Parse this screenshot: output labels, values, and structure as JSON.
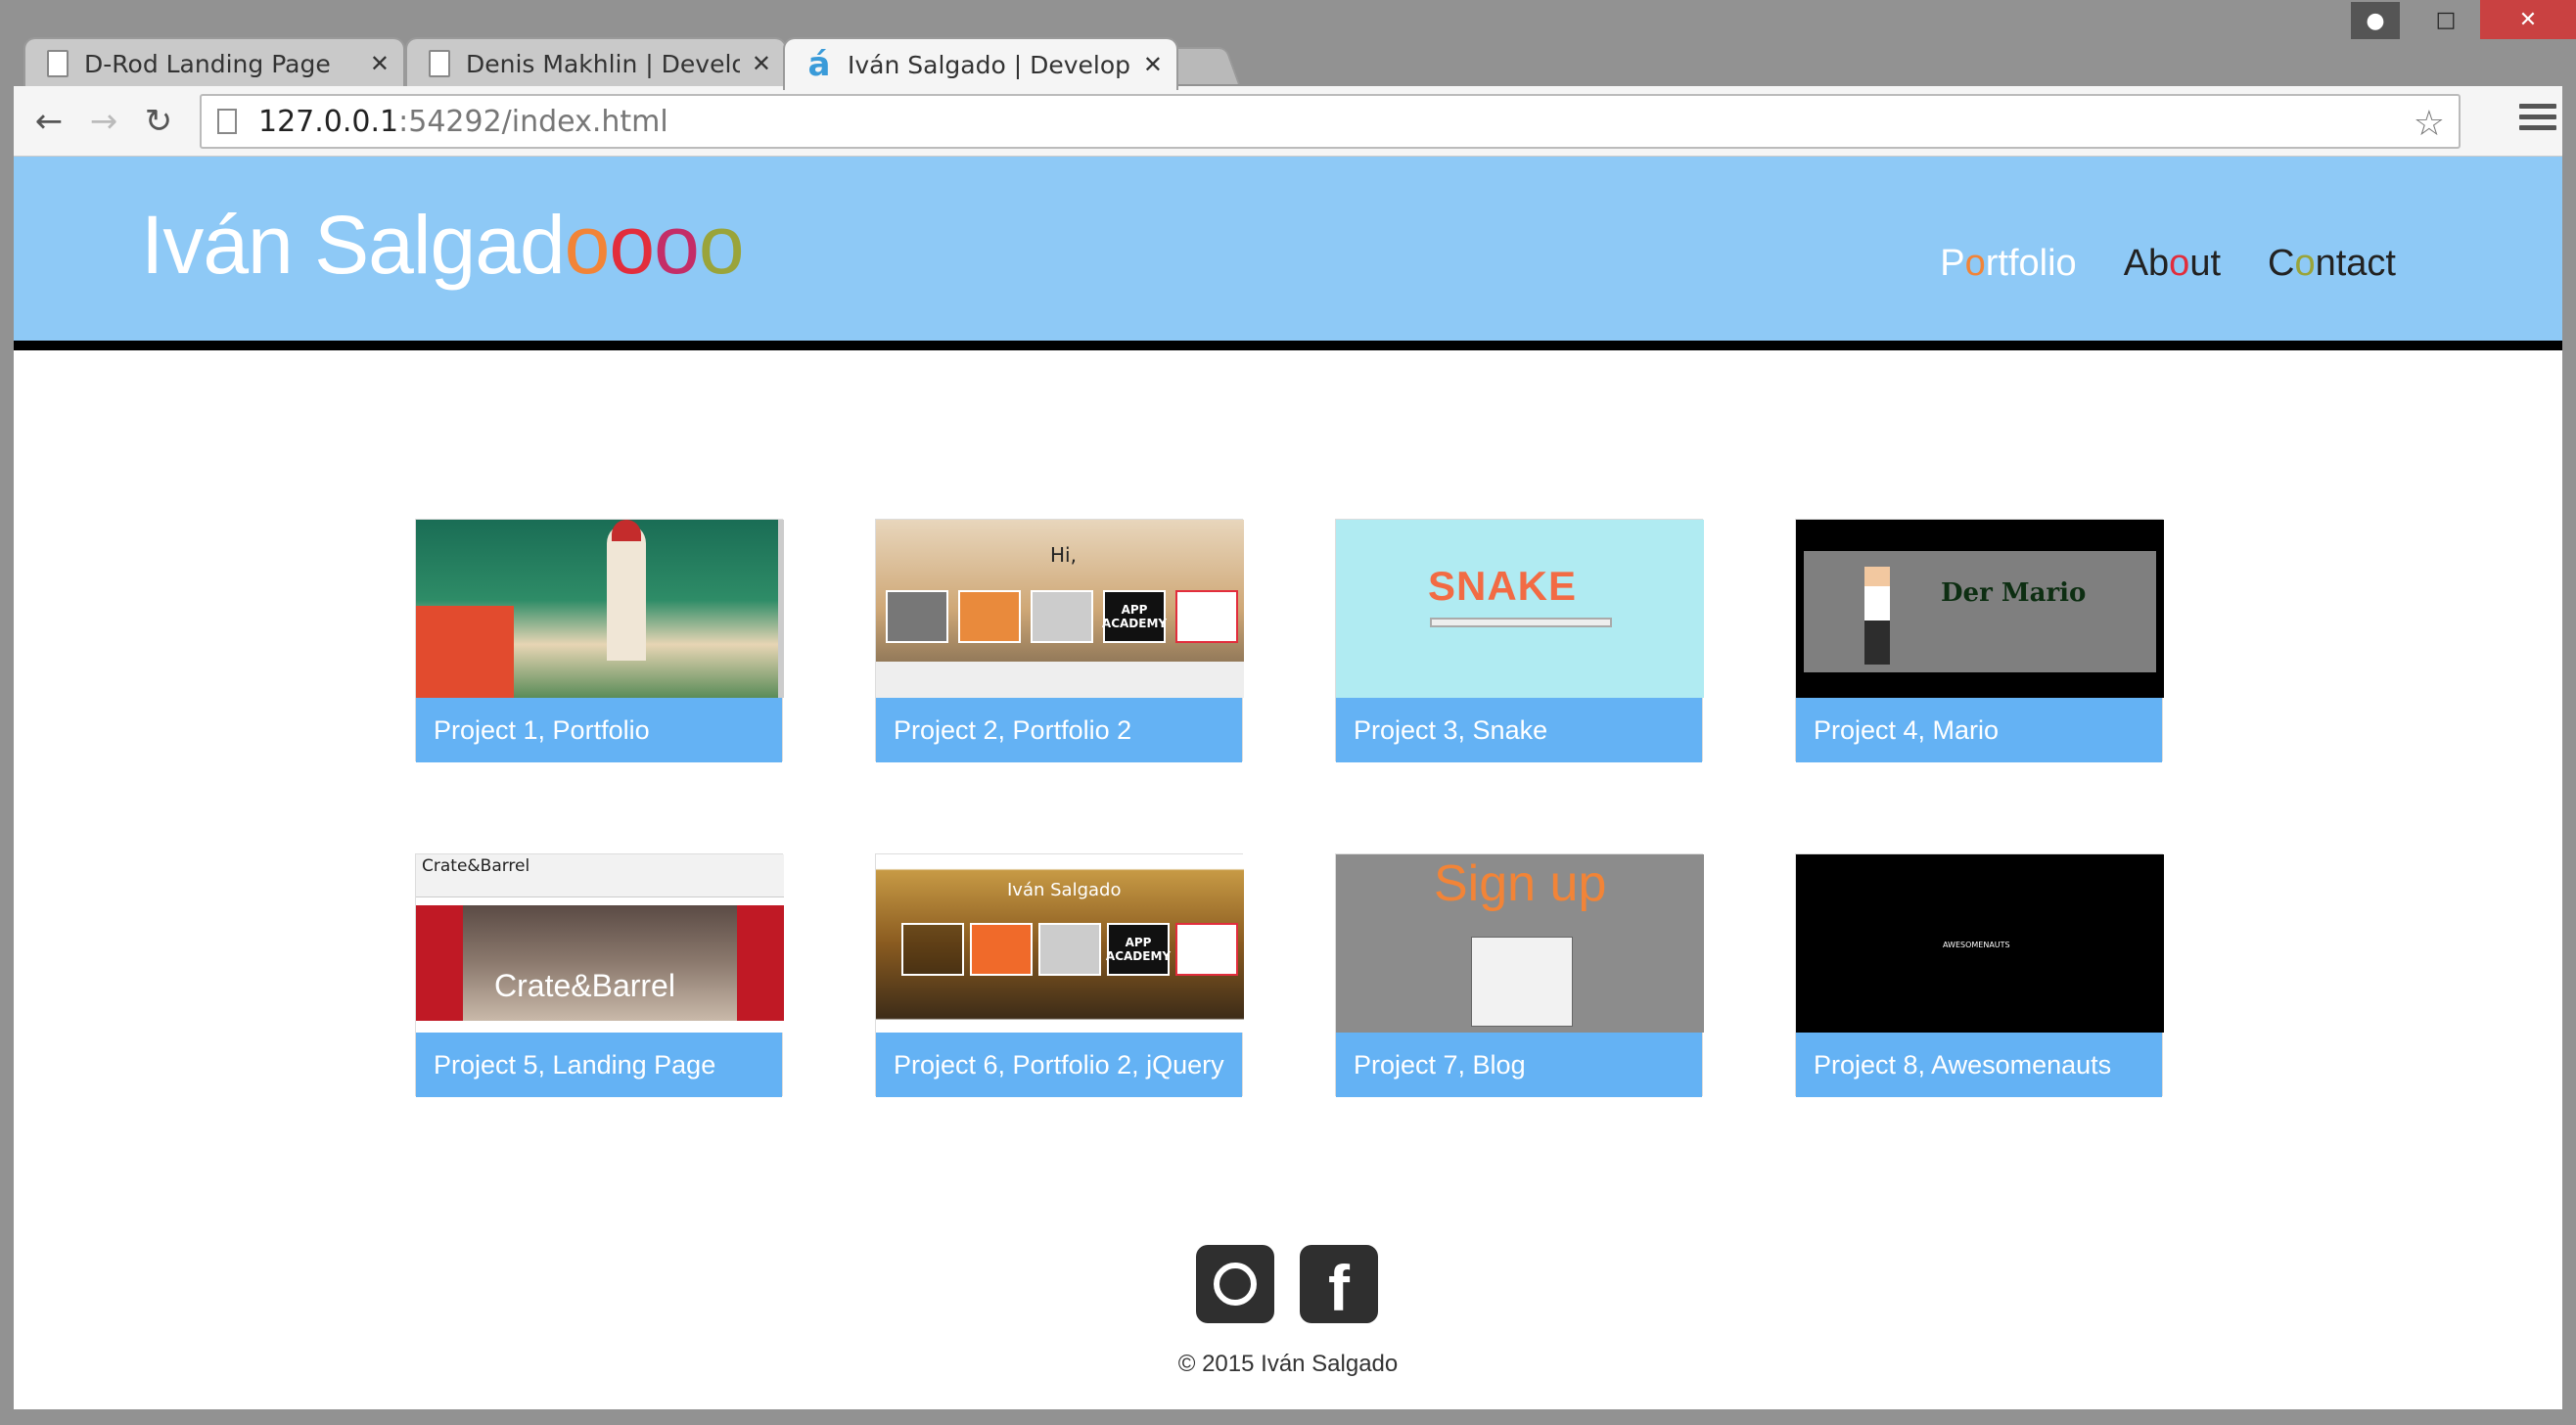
{
  "browser": {
    "tabs": [
      {
        "title": "D-Rod Landing Page",
        "icon": "page-icon"
      },
      {
        "title": "Denis Makhlin | Developer",
        "icon": "page-icon"
      },
      {
        "title": "Iván Salgado | Developer",
        "icon": "a-favicon",
        "favicon_char": "á",
        "active": true
      }
    ],
    "url_host": "127.0.0.1",
    "url_rest": ":54292/index.html",
    "close_glyph": "✕"
  },
  "site": {
    "logo_main": "Iván Salgad",
    "logo_o": [
      "o",
      "o",
      "o",
      "o"
    ],
    "nav": [
      {
        "first": "P",
        "accent": "o",
        "rest": "rtfolio",
        "active": true
      },
      {
        "first": "Ab",
        "accent": "o",
        "rest": "ut"
      },
      {
        "first": "C",
        "accent": "o",
        "rest": "ntact"
      }
    ],
    "accent_colors": [
      "#f28437",
      "#e22d3c",
      "#c42d67",
      "#9aa43a"
    ],
    "header_bg": "#8ec9f6",
    "caption_bg": "#64b2f4"
  },
  "projects": [
    {
      "caption": "Project 1, Portfolio"
    },
    {
      "caption": "Project 2, Portfolio 2",
      "thumb_text": "Hi,",
      "thumb_badge": "APP ACADEMY"
    },
    {
      "caption": "Project 3, Snake",
      "thumb_text": "SNAKE"
    },
    {
      "caption": "Project 4, Mario",
      "thumb_text": "Der Mario"
    },
    {
      "caption": "Project 5, Landing Page",
      "thumb_text": "Crate&Barrel",
      "thumb_title": "Crate&Barrel"
    },
    {
      "caption": "Project 6, Portfolio 2, jQuery",
      "thumb_text": "Iván Salgado",
      "thumb_badge": "APP ACADEMY"
    },
    {
      "caption": "Project 7, Blog",
      "thumb_text": "Sign up"
    },
    {
      "caption": "Project 8, Awesomenauts",
      "thumb_text": "AWESOMENAUTS"
    }
  ],
  "social": [
    {
      "name": "instagram-icon"
    },
    {
      "name": "facebook-icon",
      "glyph": "f"
    }
  ],
  "footer": {
    "copyright": "© 2015 Iván Salgado"
  }
}
